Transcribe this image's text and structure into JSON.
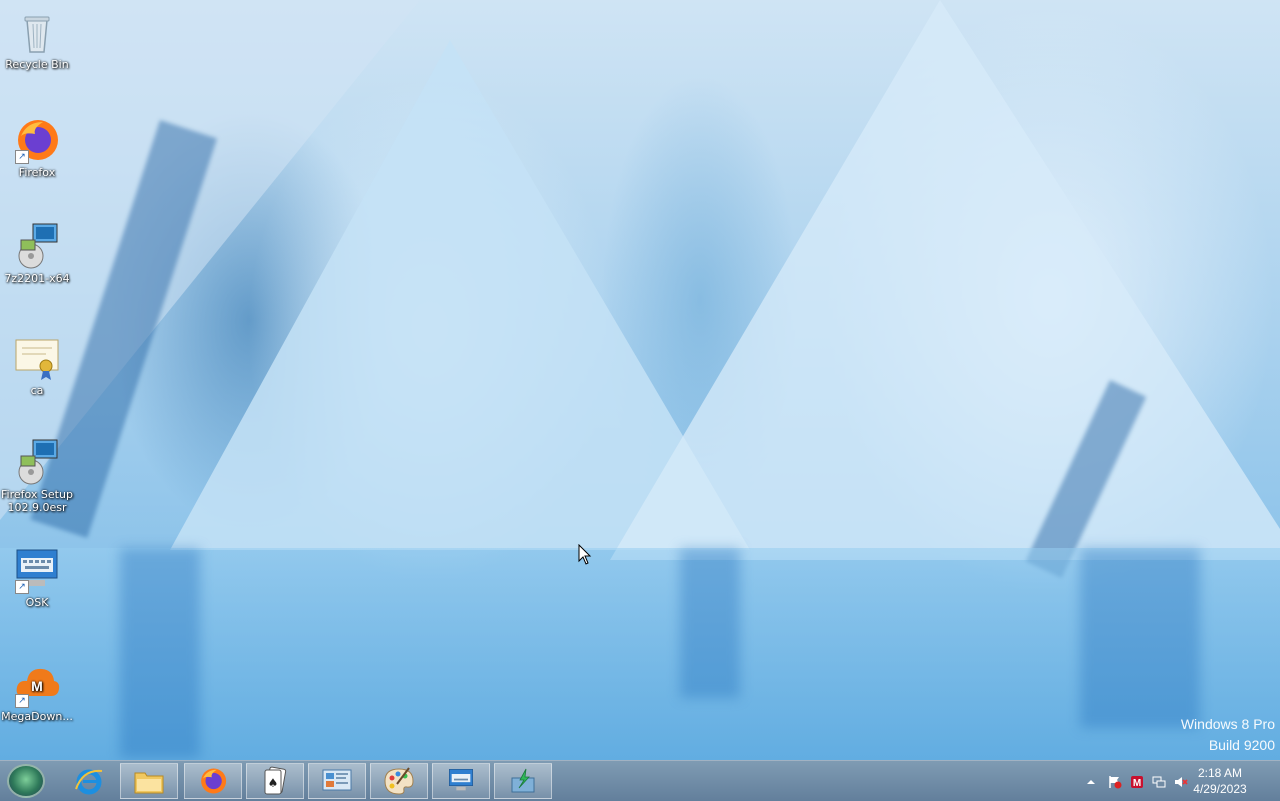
{
  "desktop": {
    "icons": [
      {
        "label": "Recycle Bin",
        "icon": "recycle-bin-icon"
      },
      {
        "label": "Firefox",
        "icon": "firefox-icon"
      },
      {
        "label": "7z2201-x64",
        "icon": "installer-icon"
      },
      {
        "label": "ca",
        "icon": "certificate-icon"
      },
      {
        "label": "Firefox Setup 102.9.0esr",
        "icon": "installer-icon"
      },
      {
        "label": "OSK",
        "icon": "keyboard-icon"
      },
      {
        "label": "MegaDown...",
        "icon": "megadownloader-icon"
      }
    ]
  },
  "watermark": {
    "line1": "Windows 8 Pro",
    "line2": "Build 9200"
  },
  "taskbar": {
    "buttons": [
      {
        "name": "internet-explorer",
        "icon": "internet-explorer-icon",
        "state": "pinned"
      },
      {
        "name": "file-explorer",
        "icon": "folder-icon",
        "state": "active"
      },
      {
        "name": "firefox",
        "icon": "firefox-icon",
        "state": "active"
      },
      {
        "name": "solitaire",
        "icon": "cards-icon",
        "state": "active"
      },
      {
        "name": "control-panel",
        "icon": "control-panel-icon",
        "state": "active"
      },
      {
        "name": "paint",
        "icon": "paint-palette-icon",
        "state": "active"
      },
      {
        "name": "osk",
        "icon": "keyboard-icon",
        "state": "active"
      },
      {
        "name": "installer",
        "icon": "install-arrow-icon",
        "state": "active"
      }
    ],
    "tray": {
      "icons": [
        "show-hidden-icon",
        "action-center-flag-icon",
        "antivirus-icon",
        "network-icon",
        "volume-muted-icon"
      ],
      "time": "2:18 AM",
      "date": "4/29/2023"
    }
  },
  "colors": {
    "taskbar": "#6f8aa3",
    "accent": "#1a5fb4"
  }
}
